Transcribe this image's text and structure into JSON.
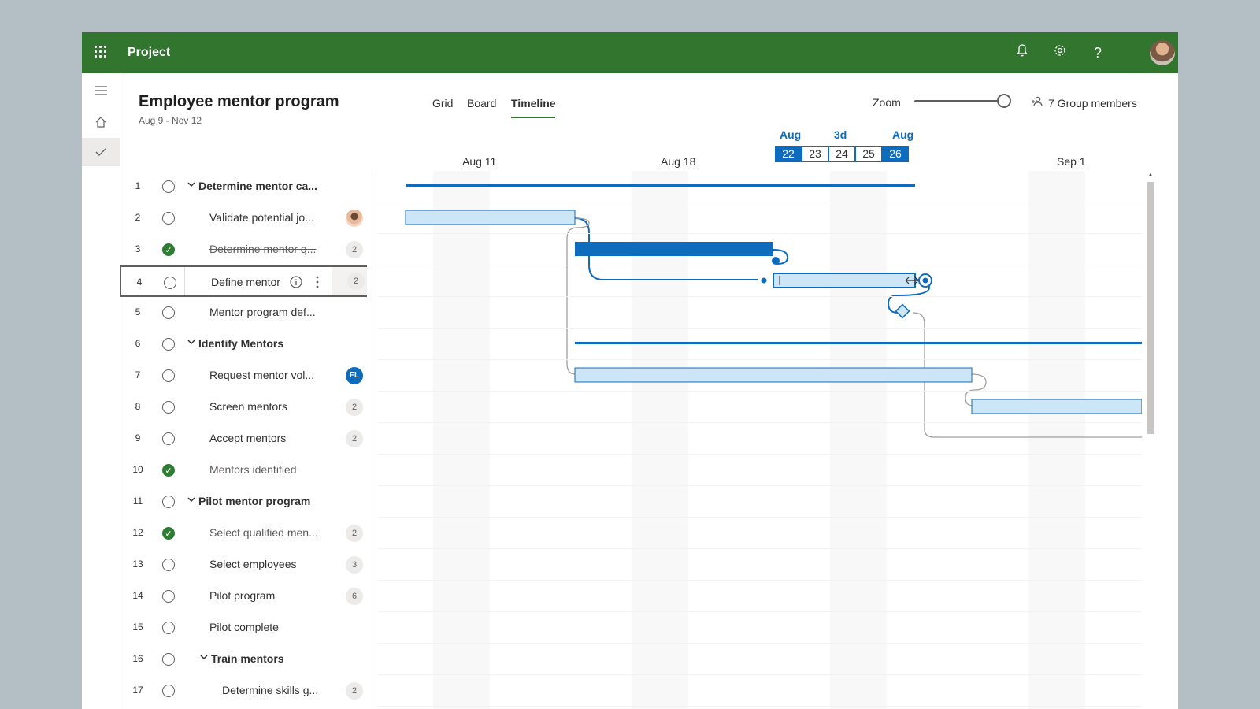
{
  "app": {
    "title": "Project"
  },
  "colors": {
    "brand": "#31752f",
    "accent": "#0f6cbd",
    "bar_light": "#cde6f7",
    "done": "#2e7d32"
  },
  "plan": {
    "title": "Employee mentor program",
    "dates": "Aug 9 - Nov 12"
  },
  "views": [
    "Grid",
    "Board",
    "Timeline"
  ],
  "active_view": "Timeline",
  "zoom": {
    "label": "Zoom",
    "level": 1.0
  },
  "members": {
    "label": "7 Group members"
  },
  "date_header": {
    "weeks": [
      "Aug 11",
      "Aug 18",
      "Sep 1"
    ],
    "selection": {
      "start_month": "Aug",
      "duration": "3d",
      "end_month": "Aug",
      "days": [
        "22",
        "23",
        "24",
        "25",
        "26"
      ]
    }
  },
  "tasks": [
    {
      "num": "1",
      "name": "Determine mentor ca...",
      "group": true,
      "done": false,
      "assign": ""
    },
    {
      "num": "2",
      "name": "Validate potential jo...",
      "group": false,
      "done": false,
      "assign": "photo"
    },
    {
      "num": "3",
      "name": "Determine mentor q...",
      "group": false,
      "done": true,
      "assign": "2"
    },
    {
      "num": "4",
      "name": "Define mentor",
      "group": false,
      "done": false,
      "assign": "2",
      "selected": true
    },
    {
      "num": "5",
      "name": "Mentor program def...",
      "group": false,
      "done": false,
      "assign": ""
    },
    {
      "num": "6",
      "name": "Identify Mentors",
      "group": true,
      "done": false,
      "assign": ""
    },
    {
      "num": "7",
      "name": "Request mentor vol...",
      "group": false,
      "done": false,
      "assign": "FL"
    },
    {
      "num": "8",
      "name": "Screen mentors",
      "group": false,
      "done": false,
      "assign": "2"
    },
    {
      "num": "9",
      "name": "Accept mentors",
      "group": false,
      "done": false,
      "assign": "2"
    },
    {
      "num": "10",
      "name": "Mentors identified",
      "group": false,
      "done": true,
      "assign": ""
    },
    {
      "num": "11",
      "name": "Pilot mentor program",
      "group": true,
      "done": false,
      "assign": ""
    },
    {
      "num": "12",
      "name": "Select qualified men...",
      "group": false,
      "done": true,
      "assign": "2"
    },
    {
      "num": "13",
      "name": "Select employees",
      "group": false,
      "done": false,
      "assign": "3"
    },
    {
      "num": "14",
      "name": "Pilot program",
      "group": false,
      "done": false,
      "assign": "6"
    },
    {
      "num": "15",
      "name": "Pilot complete",
      "group": false,
      "done": false,
      "assign": ""
    },
    {
      "num": "16",
      "name": "Train mentors",
      "group": true,
      "done": false,
      "assign": ""
    },
    {
      "num": "17",
      "name": "Determine skills g...",
      "group": false,
      "done": false,
      "assign": "2"
    }
  ]
}
